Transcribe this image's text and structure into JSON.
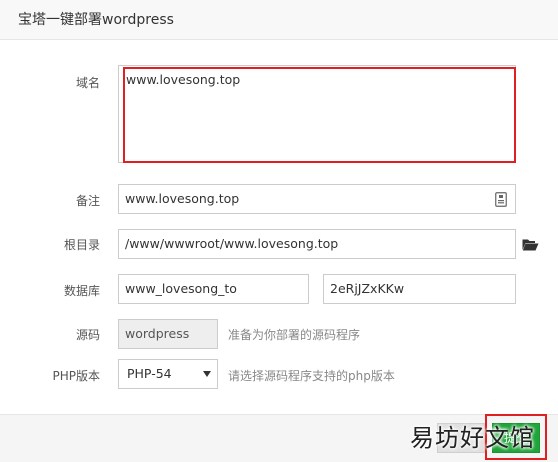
{
  "dialog": {
    "title": "宝塔一键部署wordpress"
  },
  "form": {
    "domain": {
      "label": "域名",
      "value": "www.lovesong.top"
    },
    "remark": {
      "label": "备注",
      "value": "www.lovesong.top"
    },
    "root_dir": {
      "label": "根目录",
      "value": "/www/wwwroot/www.lovesong.top"
    },
    "database": {
      "label": "数据库",
      "name_value": "www_lovesong_to",
      "password_value": "2eRjJZxKKw"
    },
    "source": {
      "label": "源码",
      "value": "wordpress",
      "hint": "准备为你部署的源码程序"
    },
    "php_version": {
      "label": "PHP版本",
      "selected": "PHP-54",
      "hint": "请选择源码程序支持的php版本"
    }
  },
  "footer": {
    "cancel_label": "",
    "submit_label": "提交"
  },
  "watermark": {
    "text": "易坊好文馆"
  },
  "colors": {
    "accent": "#20a53a",
    "highlight": "#e02020"
  },
  "icons": {
    "remark_field": "clipboard-icon",
    "folder": "folder-open-icon",
    "select": "chevron-down-icon"
  }
}
